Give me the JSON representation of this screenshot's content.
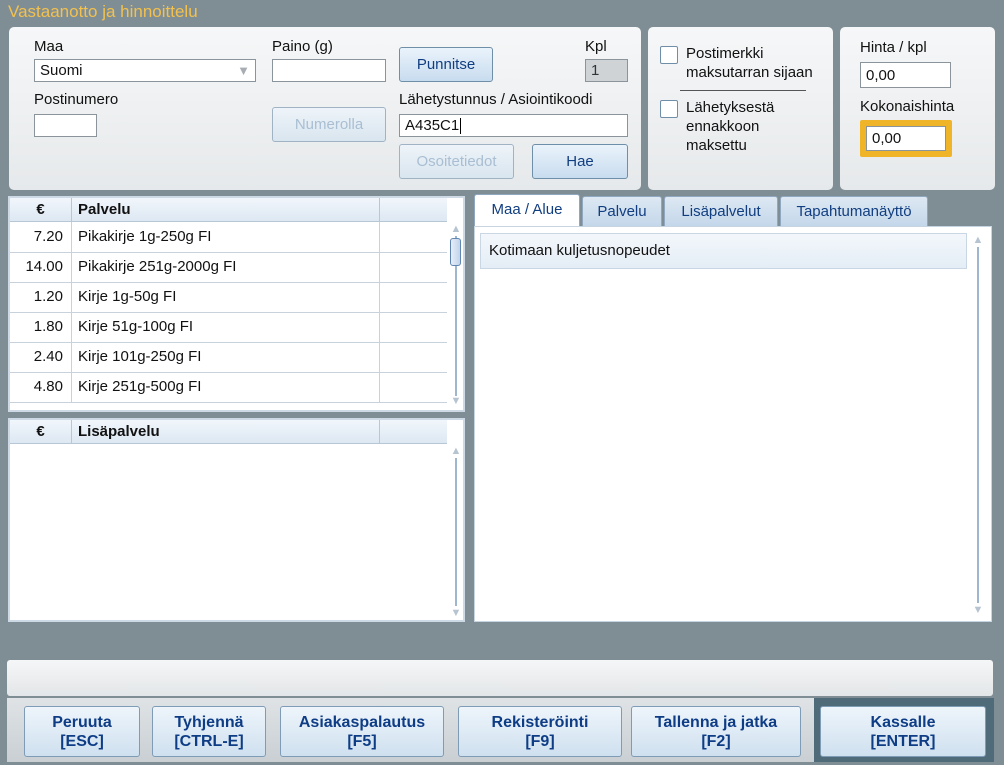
{
  "window": {
    "title": "Vastaanotto ja hinnoittelu"
  },
  "form": {
    "country_label": "Maa",
    "country_value": "Suomi",
    "weight_label": "Paino (g)",
    "weight_value": "",
    "weigh_button": "Punnitse",
    "qty_label": "Kpl",
    "qty_value": "1",
    "postcode_label": "Postinumero",
    "postcode_value": "",
    "number_button": "Numerolla",
    "tracking_label": "Lähetystunnus / Asiointikoodi",
    "tracking_value": "A435C1",
    "address_button": "Osoitetiedot",
    "fetch_button": "Hae"
  },
  "options": {
    "stamp_label": "Postimerkki maksutarran sijaan",
    "prepaid_label": "Lähetyksestä ennakkoon maksettu"
  },
  "price": {
    "unit_label": "Hinta / kpl",
    "unit_value": "0,00",
    "total_label": "Kokonaishinta",
    "total_value": "0,00"
  },
  "services_table": {
    "headers": [
      "€",
      "Palvelu",
      ""
    ],
    "rows": [
      {
        "price": "7.20",
        "name": "Pikakirje 1g-250g FI"
      },
      {
        "price": "14.00",
        "name": "Pikakirje 251g-2000g FI"
      },
      {
        "price": "1.20",
        "name": "Kirje 1g-50g FI"
      },
      {
        "price": "1.80",
        "name": "Kirje 51g-100g FI"
      },
      {
        "price": "2.40",
        "name": "Kirje 101g-250g FI"
      },
      {
        "price": "4.80",
        "name": "Kirje 251g-500g FI"
      }
    ]
  },
  "addon_table": {
    "headers": [
      "€",
      "Lisäpalvelu",
      ""
    ]
  },
  "tabs": [
    {
      "label": "Maa / Alue",
      "active": true
    },
    {
      "label": "Palvelu",
      "active": false
    },
    {
      "label": "Lisäpalvelut",
      "active": false
    },
    {
      "label": "Tapahtumanäyttö",
      "active": false
    }
  ],
  "tab_content": {
    "item": "Kotimaan kuljetusnopeudet"
  },
  "footer": {
    "buttons": [
      {
        "label": "Peruuta",
        "key": "[ESC]"
      },
      {
        "label": "Tyhjennä",
        "key": "[CTRL-E]"
      },
      {
        "label": "Asiakaspalautus",
        "key": "[F5]"
      },
      {
        "label": "Rekisteröinti",
        "key": "[F9]"
      },
      {
        "label": "Tallenna ja jatka",
        "key": "[F2]"
      },
      {
        "label": "Kassalle",
        "key": "[ENTER]"
      }
    ]
  },
  "colors": {
    "title": "#f2c14e",
    "accent": "#113e80",
    "highlight": "#f0b429"
  }
}
